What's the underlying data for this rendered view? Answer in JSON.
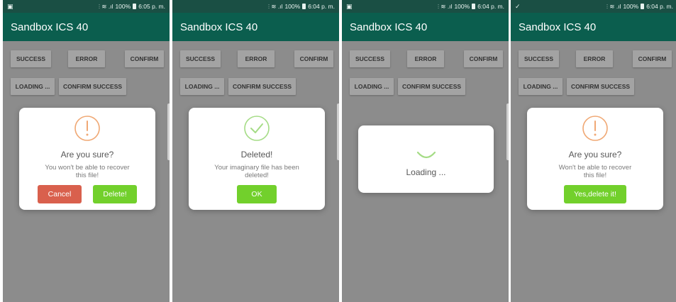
{
  "colors": {
    "statusbar": "#1a4f44",
    "appbar": "#0b5e4e",
    "overlay_bg": "#8c8c8c",
    "warning": "#f0a874",
    "success": "#a5dc86",
    "confirm_button": "#72d02c",
    "cancel_button": "#d9604d"
  },
  "screens": [
    {
      "status": {
        "signal_text": "100%",
        "time": "6:05 p. m."
      },
      "app_title": "Sandbox ICS 40",
      "buttons": [
        "SUCCESS",
        "ERROR",
        "CONFIRM",
        "LOADING ...",
        "CONFIRM SUCCESS"
      ],
      "dialog": {
        "type": "warning",
        "icon": "warning-icon",
        "title": "Are you sure?",
        "text_line1": "You won't be able to recover",
        "text_line2": "this file!",
        "cancel_label": "Cancel",
        "confirm_label": "Delete!"
      }
    },
    {
      "status": {
        "signal_text": "100%",
        "time": "6:04 p. m."
      },
      "app_title": "Sandbox ICS 40",
      "buttons": [
        "SUCCESS",
        "ERROR",
        "CONFIRM",
        "LOADING ...",
        "CONFIRM SUCCESS"
      ],
      "dialog": {
        "type": "success",
        "icon": "success-check-icon",
        "title": "Deleted!",
        "text_line1": "Your imaginary file has been",
        "text_line2": "deleted!",
        "confirm_label": "OK"
      }
    },
    {
      "status": {
        "signal_text": "100%",
        "time": "6:04 p. m."
      },
      "app_title": "Sandbox ICS 40",
      "buttons": [
        "SUCCESS",
        "ERROR",
        "CONFIRM",
        "LOADING ...",
        "CONFIRM SUCCESS"
      ],
      "dialog": {
        "type": "loading",
        "icon": "spinner-icon",
        "title": "Loading ..."
      }
    },
    {
      "status": {
        "signal_text": "100%",
        "time": "6:04 p. m."
      },
      "app_title": "Sandbox ICS 40",
      "buttons": [
        "SUCCESS",
        "ERROR",
        "CONFIRM",
        "LOADING ...",
        "CONFIRM SUCCESS"
      ],
      "dialog": {
        "type": "warning",
        "icon": "warning-icon",
        "title": "Are you sure?",
        "text_line1": "Won't be able to recover",
        "text_line2": "this file!",
        "confirm_label": "Yes,delete it!"
      }
    }
  ]
}
